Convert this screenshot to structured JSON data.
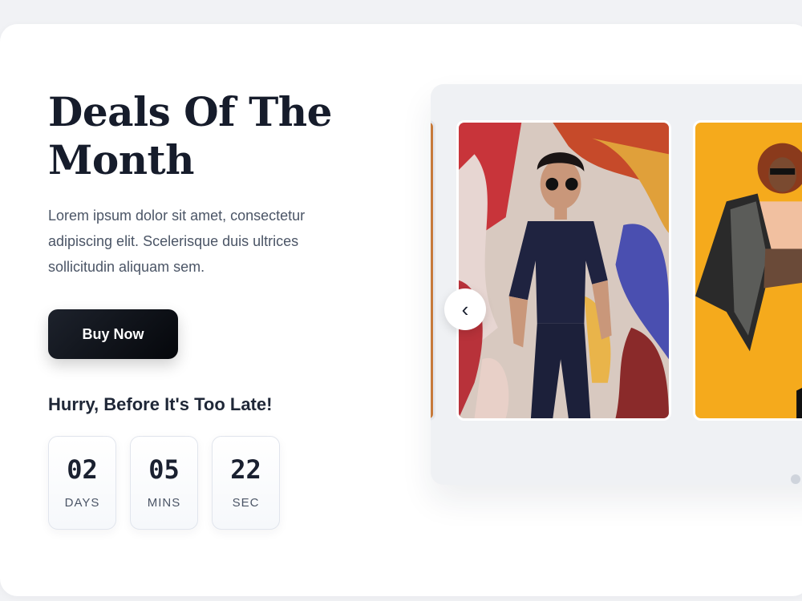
{
  "hero": {
    "title": "Deals Of The Month",
    "description": "Lorem ipsum dolor sit amet, consectetur adipiscing elit. Scelerisque duis ultrices sollicitudin aliquam sem.",
    "cta_label": "Buy Now",
    "urgency_text": "Hurry, Before It's Too Late!"
  },
  "countdown": [
    {
      "value": "02",
      "unit": "DAYS"
    },
    {
      "value": "05",
      "unit": "MINS"
    },
    {
      "value": "22",
      "unit": "SEC"
    }
  ],
  "carousel": {
    "prev_icon": "chevron-left-icon",
    "prev_glyph": "‹",
    "slides": [
      {
        "name": "woman-in-navy-outfit-graffiti-photo",
        "background": "#c4342e"
      },
      {
        "name": "woman-in-blazer-yellow-background-photo",
        "background": "#f5aa1c"
      }
    ]
  },
  "colors": {
    "accent_dark": "#0b0e14",
    "title": "#161c2b",
    "body_text": "#4b5566"
  }
}
